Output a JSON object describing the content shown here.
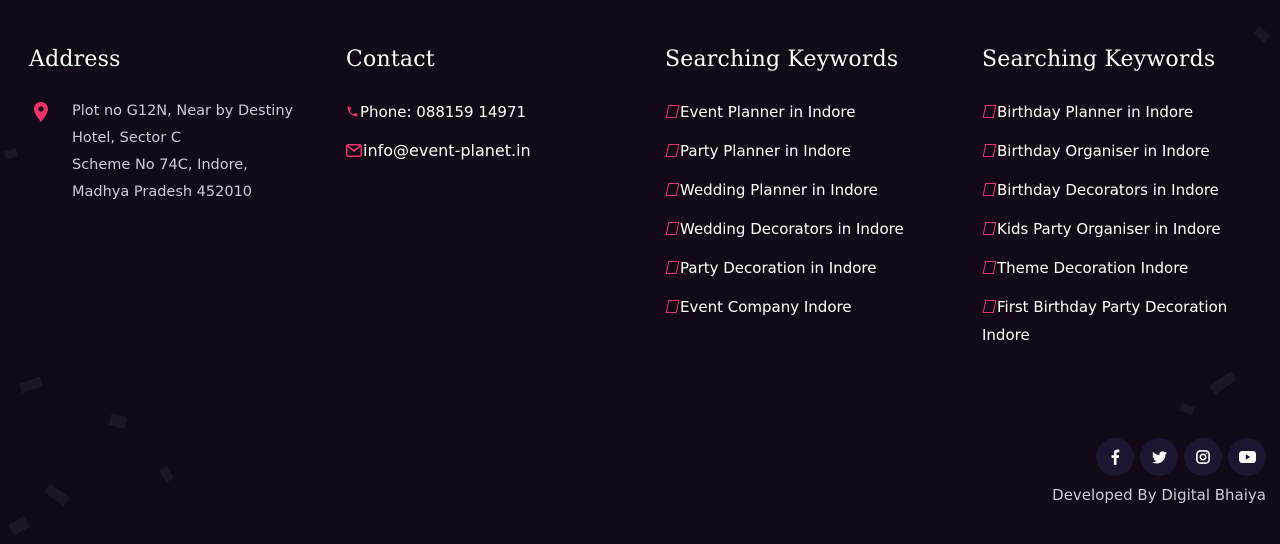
{
  "address": {
    "heading": "Address",
    "icon": "location-pin-icon",
    "lines": [
      "Plot no G12N, Near by Destiny",
      "Hotel, Sector C",
      "Scheme No 74C, Indore,",
      "Madhya Pradesh 452010"
    ]
  },
  "contact": {
    "heading": "Contact",
    "phone_label": "Phone: 088159 14971",
    "email_label": "info@event-planet.in"
  },
  "keywords_left": {
    "heading": "Searching Keywords",
    "items": [
      "Event Planner in Indore",
      "Party Planner in Indore",
      "Wedding Planner in Indore",
      "Wedding Decorators in Indore",
      "Party Decoration in Indore",
      "Event Company Indore"
    ]
  },
  "keywords_right": {
    "heading": "Searching Keywords",
    "items": [
      "Birthday Planner in Indore",
      "Birthday Organiser in Indore",
      "Birthday Decorators in Indore",
      "Kids Party Organiser in Indore",
      "Theme Decoration Indore",
      "First Birthday Party Decoration Indore"
    ]
  },
  "socials": [
    "facebook-icon",
    "twitter-icon",
    "instagram-icon",
    "youtube-icon"
  ],
  "footer": {
    "developed_by": "Developed By Digital Bhaiya"
  },
  "colors": {
    "background": "#130818",
    "accent": "#e8336b",
    "social_bg": "#1e1530"
  }
}
